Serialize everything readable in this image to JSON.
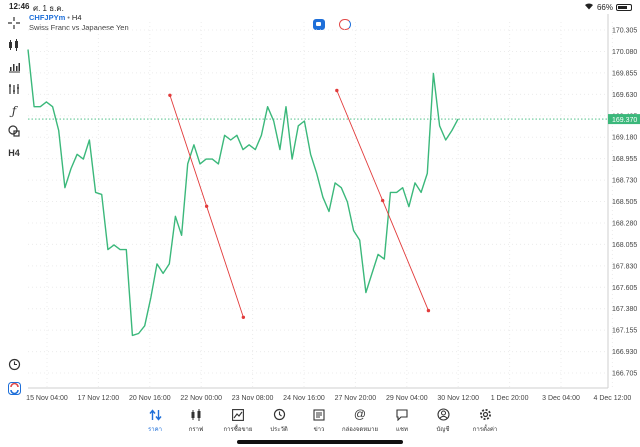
{
  "status": {
    "time": "12:46",
    "date": "ศ. 1 ธ.ค.",
    "battery": "66%"
  },
  "chart": {
    "symbol": "CHFJPYm",
    "timeframe": "H4",
    "description": "Swiss Franc vs Japanese Yen",
    "current_price": "169.370",
    "colors": {
      "line": "#3bb87b",
      "trend": "#e23b3b",
      "price_line": "#3bb87b",
      "price_tag": "#3bb87b",
      "grid": "#ececec"
    }
  },
  "left_toolbar": {
    "crosshair": "crosshair-icon",
    "indicators": "indicators-icon",
    "chart_type": "bar-chart-icon",
    "objects": "objects-icon",
    "function": "function-icon",
    "shapes": "shapes-icon",
    "timeframe_label": "H4",
    "alarm": "alarm-clock-icon",
    "brand": "brand-icon"
  },
  "chart_data": {
    "type": "line",
    "y_ticks": [
      "170.305",
      "170.080",
      "169.855",
      "169.630",
      "169.405",
      "169.180",
      "168.955",
      "168.730",
      "168.505",
      "168.280",
      "168.055",
      "167.830",
      "167.605",
      "167.380",
      "167.155",
      "166.930",
      "166.705"
    ],
    "x_ticks": [
      "15 Nov 04:00",
      "17 Nov 12:00",
      "20 Nov 16:00",
      "22 Nov 00:00",
      "23 Nov 08:00",
      "24 Nov 16:00",
      "27 Nov 20:00",
      "29 Nov 04:00",
      "30 Nov 12:00",
      "1 Dec 20:00",
      "3 Dec 04:00",
      "4 Dec 12:00"
    ],
    "ylim": [
      166.705,
      170.305
    ],
    "series": [
      {
        "values": [
          170.1,
          169.5,
          169.5,
          169.55,
          169.5,
          169.25,
          168.65,
          168.85,
          169.0,
          168.95,
          169.15,
          168.6,
          168.58,
          168.0,
          168.05,
          168.0,
          168.0,
          167.1,
          167.12,
          167.2,
          167.5,
          167.85,
          167.75,
          167.85,
          168.35,
          168.15,
          168.9,
          169.1,
          168.9,
          168.95,
          168.95,
          168.9,
          169.2,
          169.15,
          169.2,
          169.05,
          169.1,
          169.05,
          169.2,
          169.5,
          169.35,
          169.05,
          169.5,
          168.95,
          169.3,
          169.35,
          169.0,
          168.8,
          168.55,
          168.4,
          168.7,
          168.65,
          168.5,
          168.2,
          168.1,
          167.55,
          167.75,
          167.95,
          167.9,
          168.6,
          168.6,
          168.65,
          168.45,
          168.7,
          168.6,
          168.8,
          169.85,
          169.3,
          169.15,
          169.25,
          169.37
        ]
      }
    ],
    "trendlines": [
      {
        "x": [
          0.2447,
          0.3713
        ],
        "y": [
          169.62,
          167.29
        ]
      },
      {
        "x": [
          0.5325,
          0.6904
        ],
        "y": [
          169.67,
          167.36
        ]
      }
    ]
  },
  "bottom_nav": {
    "items": [
      {
        "label": "ราคา",
        "icon": "quotes-icon"
      },
      {
        "label": "กราฟ",
        "icon": "chart-icon"
      },
      {
        "label": "การซื้อขาย",
        "icon": "trade-icon"
      },
      {
        "label": "ประวัติ",
        "icon": "history-icon"
      },
      {
        "label": "ข่าว",
        "icon": "news-icon"
      },
      {
        "label": "กล่องจดหมาย",
        "icon": "mailbox-icon"
      },
      {
        "label": "แชท",
        "icon": "chat-icon"
      },
      {
        "label": "บัญชี",
        "icon": "account-icon"
      },
      {
        "label": "การตั้งค่า",
        "icon": "settings-icon"
      }
    ]
  }
}
